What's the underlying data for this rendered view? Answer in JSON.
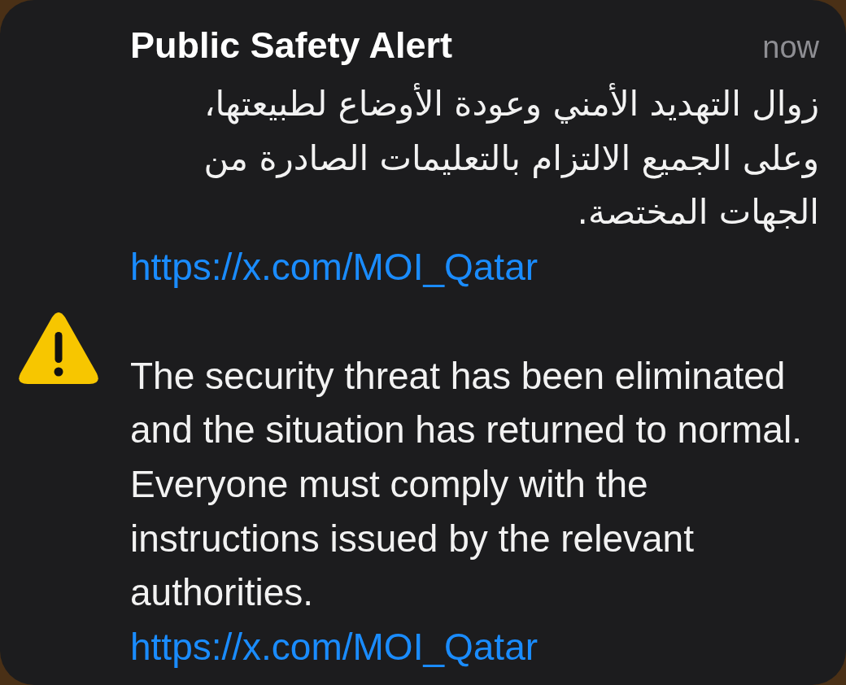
{
  "notification": {
    "title": "Public Safety Alert",
    "time": "now",
    "messages": [
      {
        "kind": "rtl",
        "text": "زوال التهديد الأمني وعودة الأوضاع لطبيعتها،\nوعلى الجميع الالتزام بالتعليمات الصادرة من\nالجهات المختصة.",
        "link": "https://x.com/MOI_Qatar"
      },
      {
        "kind": "ltr",
        "text": "The security threat has been eliminated and the situation has returned to normal. Everyone must comply with the instructions issued by the relevant authorities.",
        "link": "https://x.com/MOI_Qatar"
      }
    ]
  }
}
